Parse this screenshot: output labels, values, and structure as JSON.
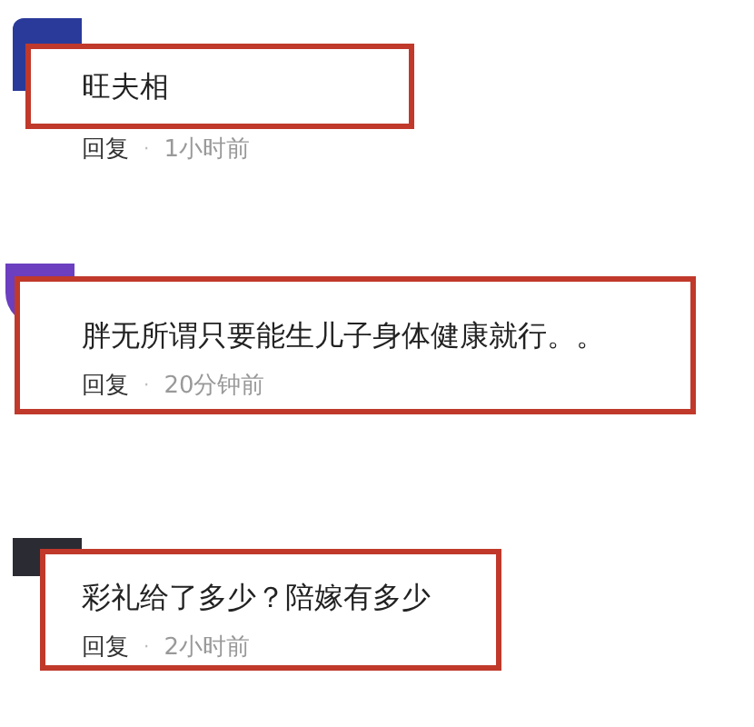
{
  "comments": [
    {
      "text": "旺夫相",
      "reply_label": "回复",
      "separator": "·",
      "time": "1小时前",
      "highlighted": true
    },
    {
      "text": "胖无所谓只要能生儿子身体健康就行。。",
      "reply_label": "回复",
      "separator": "·",
      "time": "20分钟前",
      "highlighted": true
    },
    {
      "text": "彩礼给了多少？陪嫁有多少",
      "reply_label": "回复",
      "separator": "·",
      "time": "2小时前",
      "highlighted": true
    }
  ]
}
